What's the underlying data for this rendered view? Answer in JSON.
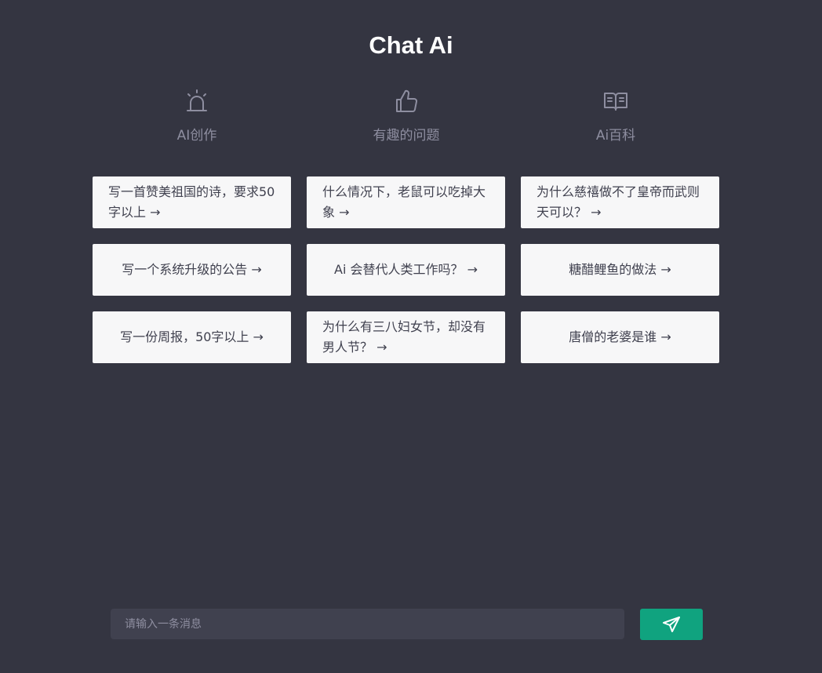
{
  "app": {
    "title": "Chat Ai"
  },
  "categories": [
    {
      "label": "AI创作",
      "icon": "alarm-icon"
    },
    {
      "label": "有趣的问题",
      "icon": "thumbs-up-icon"
    },
    {
      "label": "Ai百科",
      "icon": "book-open-icon"
    }
  ],
  "prompts": [
    {
      "text": "写一首赞美祖国的诗，要求50字以上 →"
    },
    {
      "text": "什么情况下，老鼠可以吃掉大象 →"
    },
    {
      "text": "为什么慈禧做不了皇帝而武则天可以？ →"
    },
    {
      "text": "写一个系统升级的公告 →"
    },
    {
      "text": "Ai 会替代人类工作吗？ →"
    },
    {
      "text": "糖醋鲤鱼的做法 →"
    },
    {
      "text": "写一份周报，50字以上 →"
    },
    {
      "text": "为什么有三八妇女节，却没有男人节？ →"
    },
    {
      "text": "唐僧的老婆是谁 →"
    }
  ],
  "composer": {
    "placeholder": "请输入一条消息",
    "value": ""
  },
  "send_button": {
    "icon": "send-icon"
  },
  "colors": {
    "background": "#343541",
    "card": "#f7f7f8",
    "input": "#40414f",
    "accent": "#10a37f",
    "muted": "#8e8ea0"
  }
}
